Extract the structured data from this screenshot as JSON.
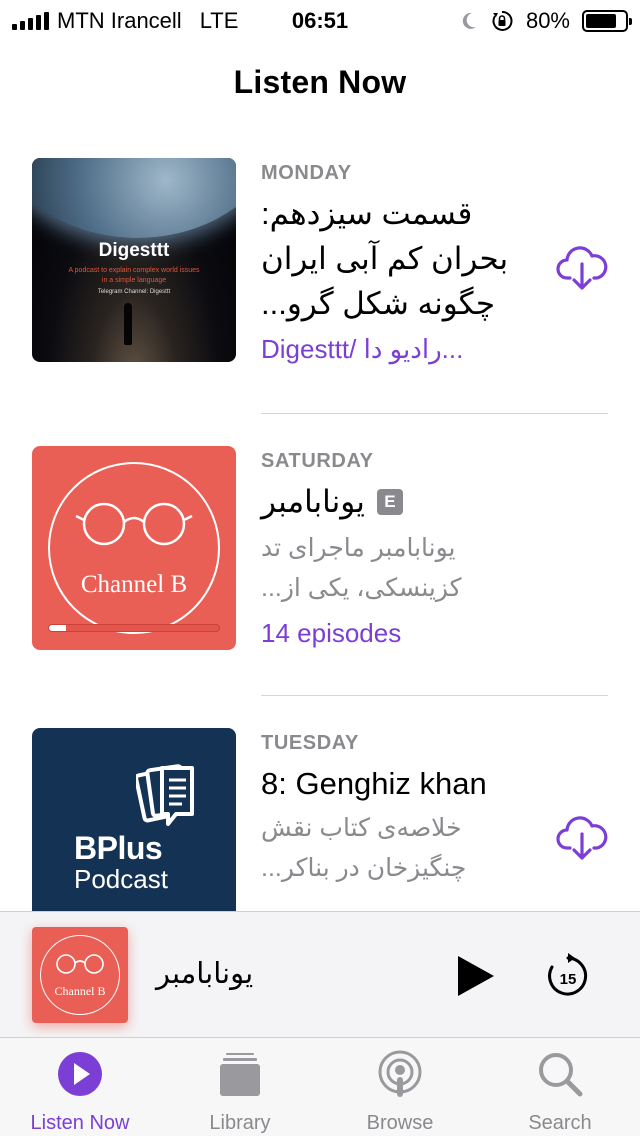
{
  "status_bar": {
    "carrier": "MTN Irancell",
    "network": "LTE",
    "time": "06:51",
    "battery_percent": "80%",
    "battery_level": 0.8,
    "icons": [
      "signal-icon",
      "moon-icon",
      "rotation-lock-icon",
      "battery-icon"
    ]
  },
  "page": {
    "title": "Listen Now"
  },
  "episodes": [
    {
      "day": "MONDAY",
      "title_lines": [
        "قسمت سیزدهم:",
        "بحران کم آبی ایران",
        "چگونه شکل گرو..."
      ],
      "meta": "Digesttt/ رادیو دا...",
      "artwork": {
        "title": "Digesttt",
        "tagline_1": "A podcast to explain complex world issues",
        "tagline_2": "in a simple language",
        "telegram": "Telegram Channel: Digesttt"
      },
      "action_icon": "download-cloud-icon"
    },
    {
      "day": "SATURDAY",
      "title": "یونابامبر",
      "badge": "E",
      "desc_lines": [
        "یونابامبر ماجرای تد",
        "کزینسکی، یکی از..."
      ],
      "meta": "14 episodes",
      "artwork": {
        "label": "Channel B",
        "progress": 0.1
      }
    },
    {
      "day": "TUESDAY",
      "title": "8: Genghiz khan",
      "desc_lines": [
        "خلاصه‌ی کتاب نقش",
        "چنگیزخان در بناکر..."
      ],
      "artwork": {
        "title": "BPlus",
        "subtitle": "Podcast"
      },
      "action_icon": "download-cloud-icon"
    }
  ],
  "mini_player": {
    "title": "یونابامبر",
    "artwork_label": "Channel B",
    "skip_seconds": "15"
  },
  "tabs": [
    {
      "label": "Listen Now",
      "icon": "play-circle-icon",
      "active": true
    },
    {
      "label": "Library",
      "icon": "library-stack-icon",
      "active": false
    },
    {
      "label": "Browse",
      "icon": "podcast-icon",
      "active": false
    },
    {
      "label": "Search",
      "icon": "search-icon",
      "active": false
    }
  ],
  "colors": {
    "accent": "#7b3fd6",
    "secondary_text": "#8a8a8e",
    "channel_b_red": "#ea5f55",
    "bplus_navy": "#143253"
  }
}
